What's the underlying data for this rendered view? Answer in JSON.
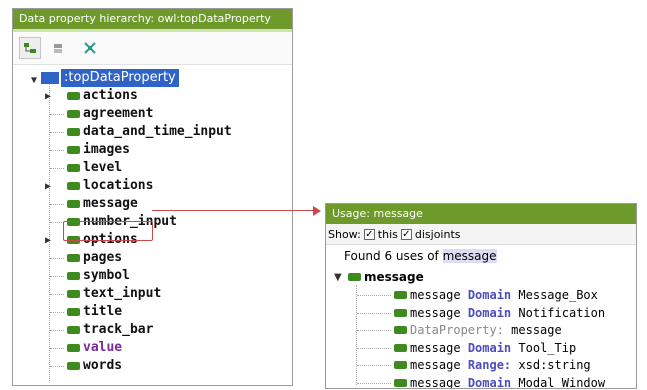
{
  "left_panel": {
    "title": "Data property hierarchy: owl:topDataProperty",
    "toolbar_icons": [
      "add-subproperty-icon",
      "add-sibling-icon",
      "delete-icon"
    ],
    "root_label": ":topDataProperty",
    "items": [
      {
        "label": "actions",
        "expandable": true
      },
      {
        "label": "agreement",
        "expandable": false
      },
      {
        "label": "data_and_time_input",
        "expandable": false
      },
      {
        "label": "images",
        "expandable": false
      },
      {
        "label": "level",
        "expandable": false
      },
      {
        "label": "locations",
        "expandable": true
      },
      {
        "label": "message",
        "expandable": false,
        "highlighted": true
      },
      {
        "label": "number_input",
        "expandable": false
      },
      {
        "label": "options",
        "expandable": true
      },
      {
        "label": "pages",
        "expandable": false
      },
      {
        "label": "symbol",
        "expandable": false
      },
      {
        "label": "text_input",
        "expandable": false
      },
      {
        "label": "title",
        "expandable": false
      },
      {
        "label": "track_bar",
        "expandable": false
      },
      {
        "label": "value",
        "expandable": false
      },
      {
        "label": "words",
        "expandable": false
      }
    ]
  },
  "right_panel": {
    "title": "Usage: message",
    "show_label": "Show:",
    "this_label": "this",
    "disjoints_label": "disjoints",
    "this_checked": true,
    "disjoints_checked": true,
    "found_prefix": "Found 6 uses of",
    "found_term": "message",
    "root": "message",
    "uses": [
      {
        "subject": "message",
        "keyword": "Domain",
        "object": "Message_Box"
      },
      {
        "subject": "message",
        "keyword": "Domain",
        "object": "Notification"
      },
      {
        "subject": "DataProperty:",
        "keyword": "",
        "object": "message"
      },
      {
        "subject": "message",
        "keyword": "Domain",
        "object": "Tool_Tip"
      },
      {
        "subject": "message",
        "keyword": "Range:",
        "object": "xsd:string"
      },
      {
        "subject": "message",
        "keyword": "Domain",
        "object": "Modal_Window"
      }
    ]
  },
  "colors": {
    "title_bar": "#6d9a2a",
    "selection": "#2f63c6",
    "class_icon": "#3f8a1f",
    "highlight": "#c94a4a",
    "keyword": "#4d4dc0",
    "value_item": "#7a2a9a"
  }
}
